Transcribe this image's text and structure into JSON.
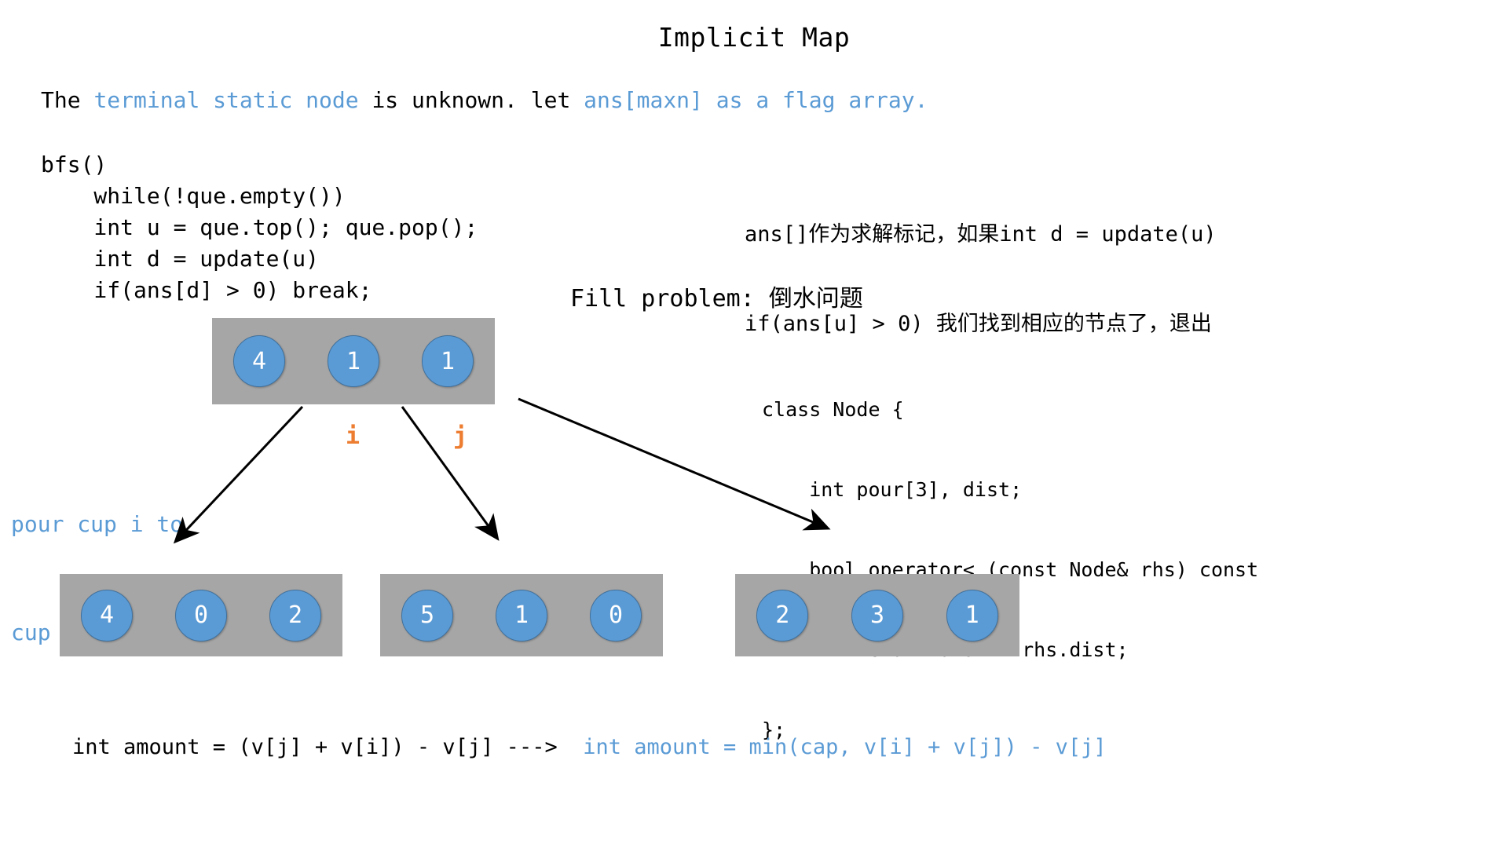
{
  "title": "Implicit Map",
  "intro": {
    "line1_a": "The ",
    "line1_b": "terminal static node",
    "line1_c": " is unknown. let ",
    "line1_d": "ans[maxn] as a flag array."
  },
  "bfs": {
    "lines": [
      "bfs()",
      "    while(!que.empty())",
      "    int u = que.top(); que.pop();",
      "    int d = update(u)",
      "    if(ans[d] > 0) break;"
    ]
  },
  "cn_note": {
    "line1": "ans[]作为求解标记，如果int d = update(u)",
    "line2": "if(ans[u] > 0) 我们找到相应的节点了，退出"
  },
  "fill_heading": {
    "en": "Fill problem:",
    "cn": " 倒水问题"
  },
  "node_class": {
    "lines": [
      "class Node {",
      "    int pour[3], dist;",
      "    bool operator< (const Node& rhs) const",
      "        return dist > rhs.dist;",
      "};"
    ]
  },
  "pour_label": {
    "line1": "pour cup i to",
    "line2": "cup j"
  },
  "markers": {
    "i": "i",
    "j": "j"
  },
  "cups": {
    "top": [
      "4",
      "1",
      "1"
    ],
    "bottom_left": [
      "4",
      "0",
      "2"
    ],
    "bottom_mid": [
      "5",
      "1",
      "0"
    ],
    "bottom_right": [
      "2",
      "3",
      "1"
    ]
  },
  "formula": {
    "black": "int amount = (v[j] + v[i]) - v[j] --->  ",
    "blue": "int amount = min(cap, v[i] + v[j]) - v[j]"
  },
  "colors": {
    "accent_blue": "#5b9bd5",
    "accent_orange": "#ed7d31",
    "box_gray": "#a6a6a6",
    "text_black": "#000000",
    "background": "#ffffff"
  }
}
